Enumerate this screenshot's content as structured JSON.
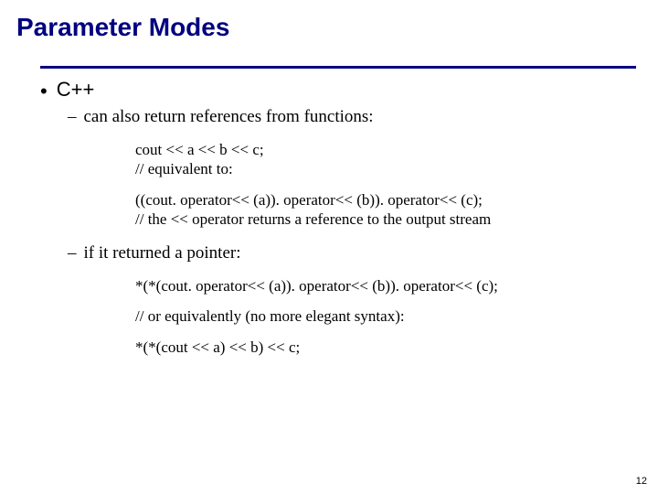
{
  "title": "Parameter Modes",
  "bullet1": "C++",
  "sub1": "can also return references from functions:",
  "code1": {
    "l1": "cout << a << b << c;",
    "l2": "// equivalent to:",
    "l3": "((cout. operator<< (a)). operator<< (b)). operator<< (c);",
    "l4": "// the << operator returns a reference to the output stream"
  },
  "sub2": "if it returned a pointer:",
  "code2": {
    "l1": "*(*(cout. operator<< (a)). operator<< (b)). operator<< (c);",
    "l2": "// or equivalently (no more elegant syntax):",
    "l3": "*(*(cout << a) << b) << c;"
  },
  "pageNumber": "12"
}
